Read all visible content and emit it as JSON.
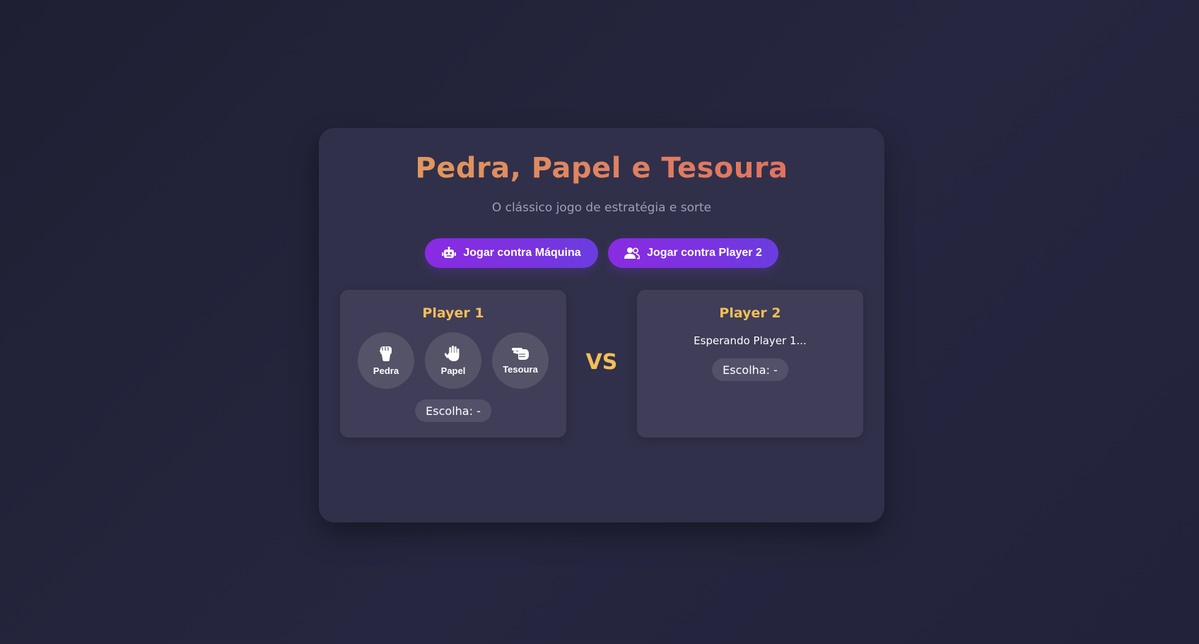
{
  "game": {
    "title": "Pedra, Papel e Tesoura",
    "subtitle": "O clássico jogo de estratégia e sorte"
  },
  "modes": {
    "machine": {
      "label": "Jogar contra Máquina",
      "icon": "robot-icon"
    },
    "player2": {
      "label": "Jogar contra Player 2",
      "icon": "users-icon"
    }
  },
  "player1": {
    "title": "Player 1",
    "choices": [
      {
        "label": "Pedra",
        "icon": "fist-icon"
      },
      {
        "label": "Papel",
        "icon": "hand-paper-icon"
      },
      {
        "label": "Tesoura",
        "icon": "hand-scissors-icon"
      }
    ],
    "selection": "Escolha: -"
  },
  "versus": "VS",
  "player2": {
    "title": "Player 2",
    "status": "Esperando Player 1...",
    "selection": "Escolha: -"
  },
  "colors": {
    "accent_gold": "#f4bf57",
    "button_purple": "#8a2be2",
    "title_gradient_start": "#e0a35a",
    "title_gradient_end": "#e06a5f"
  }
}
